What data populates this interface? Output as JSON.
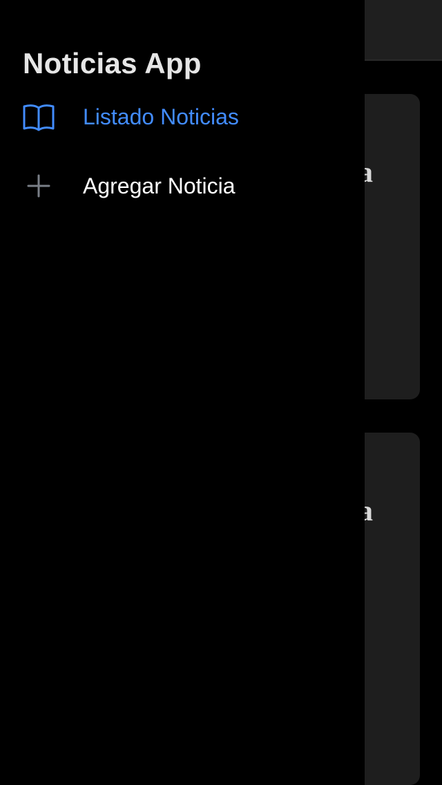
{
  "background": {
    "cards": [
      {
        "title_fragment": "a"
      },
      {
        "title_fragment": "a"
      }
    ]
  },
  "menu": {
    "title": "Noticias App",
    "items": [
      {
        "label": "Listado Noticias",
        "icon": "book-outline-icon",
        "selected": true
      },
      {
        "label": "Agregar Noticia",
        "icon": "add-icon",
        "selected": false
      }
    ]
  },
  "colors": {
    "accent": "#428cff",
    "menu_background": "#000000",
    "card_background": "#1e1e1e",
    "toolbar_background": "#1f1f1f"
  }
}
